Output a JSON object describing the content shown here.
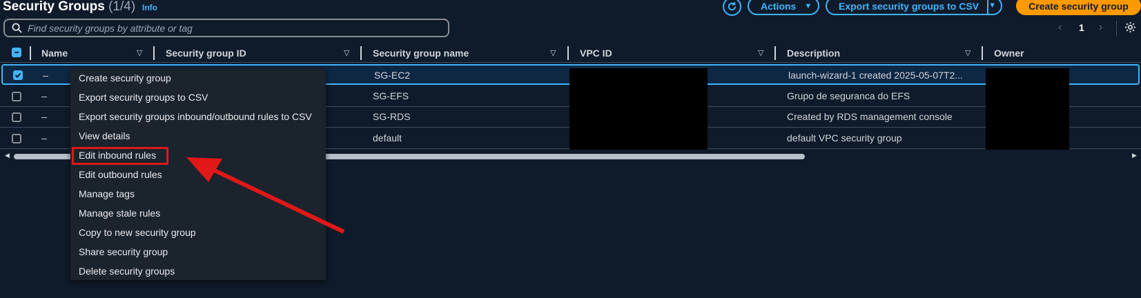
{
  "header": {
    "title": "Security Groups",
    "count": "(1/4)",
    "info_link": "Info",
    "actions_label": "Actions",
    "export_label": "Export security groups to CSV",
    "create_label": "Create security group"
  },
  "search": {
    "placeholder": "Find security groups by attribute or tag"
  },
  "pagination": {
    "current_page": "1"
  },
  "table": {
    "columns": [
      "Name",
      "Security group ID",
      "Security group name",
      "VPC ID",
      "Description",
      "Owner"
    ],
    "rows": [
      {
        "selected": true,
        "name": "–",
        "sg_name": "SG-EC2",
        "description": "launch-wizard-1 created 2025-05-07T2..."
      },
      {
        "selected": false,
        "name": "–",
        "sg_name": "SG-EFS",
        "description": "Grupo de seguranca do EFS"
      },
      {
        "selected": false,
        "name": "–",
        "sg_name": "SG-RDS",
        "description": "Created by RDS management console"
      },
      {
        "selected": false,
        "name": "–",
        "sg_name": "default",
        "description": "default VPC security group"
      }
    ]
  },
  "actions_menu": {
    "items": [
      "Create security group",
      "Export security groups to CSV",
      "Export security groups inbound/outbound rules to CSV",
      "View details",
      "Edit inbound rules",
      "Edit outbound rules",
      "Manage tags",
      "Manage stale rules",
      "Copy to new security group",
      "Share security group",
      "Delete security groups"
    ],
    "highlighted_item": "Edit inbound rules"
  },
  "annotation": {
    "highlight_color": "#e01818",
    "arrow_color": "#e01818"
  },
  "colors": {
    "accent": "#42b4ff",
    "primary_button": "#ff9900",
    "background": "#0f1b2a"
  }
}
